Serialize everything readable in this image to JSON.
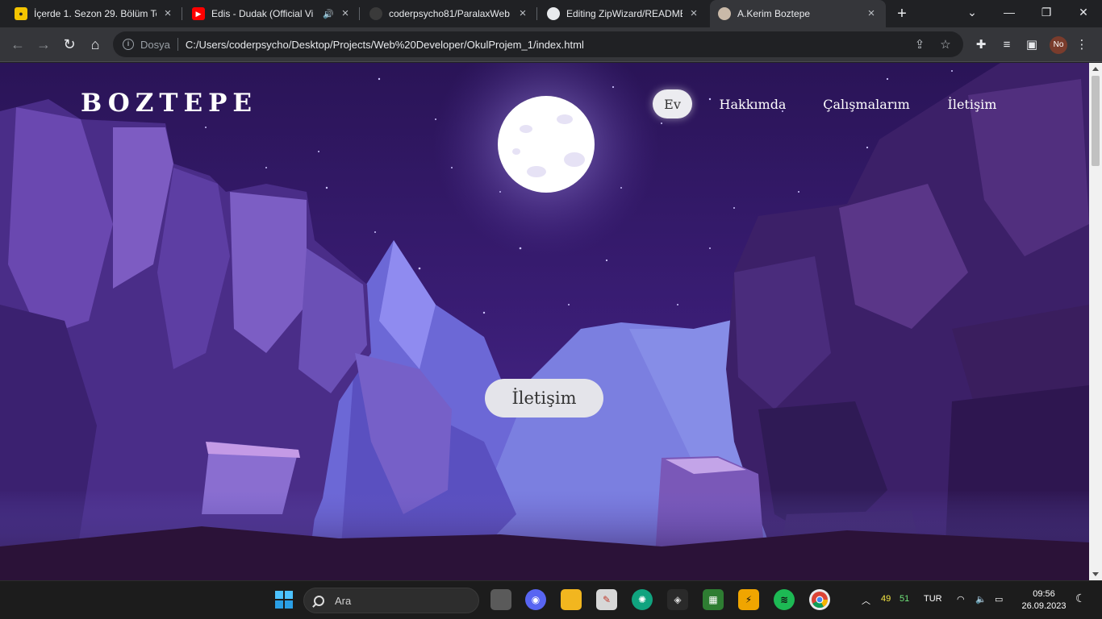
{
  "browser": {
    "tabs": [
      {
        "title": "İçerde 1. Sezon 29. Bölüm Te",
        "favicon": "streaming-icon",
        "favicon_color": "#f4c400",
        "active": false
      },
      {
        "title": "Edis - Dudak (Official Vi",
        "favicon": "youtube-icon",
        "favicon_color": "#ff0000",
        "audio": true,
        "active": false
      },
      {
        "title": "coderpsycho81/ParalaxWeb",
        "favicon": "github-icon",
        "active": false
      },
      {
        "title": "Editing ZipWizard/README.",
        "favicon": "github-icon",
        "active": false
      },
      {
        "title": "A.Kerim Boztepe",
        "favicon": "avatar-icon",
        "active": true
      }
    ],
    "omnibox": {
      "security_label": "Dosya",
      "url": "C:/Users/coderpsycho/Desktop/Projects/Web%20Developer/OkulProjem_1/index.html"
    },
    "profile_initials": "No"
  },
  "page": {
    "logo": "BOZTEPE",
    "nav": [
      {
        "label": "Ev",
        "active": true
      },
      {
        "label": "Hakkımda",
        "active": false
      },
      {
        "label": "Çalışmalarım",
        "active": false
      },
      {
        "label": "İletişim",
        "active": false
      }
    ],
    "cta_label": "İletişim",
    "colors": {
      "sky": "#2a1457",
      "accent_button": "#e4e4ea"
    }
  },
  "taskbar": {
    "search_label": "Ara",
    "tray": {
      "temp_cpu": "49",
      "temp_gpu": "51",
      "language": "TUR"
    },
    "time": "09:56",
    "date": "26.09.2023"
  }
}
